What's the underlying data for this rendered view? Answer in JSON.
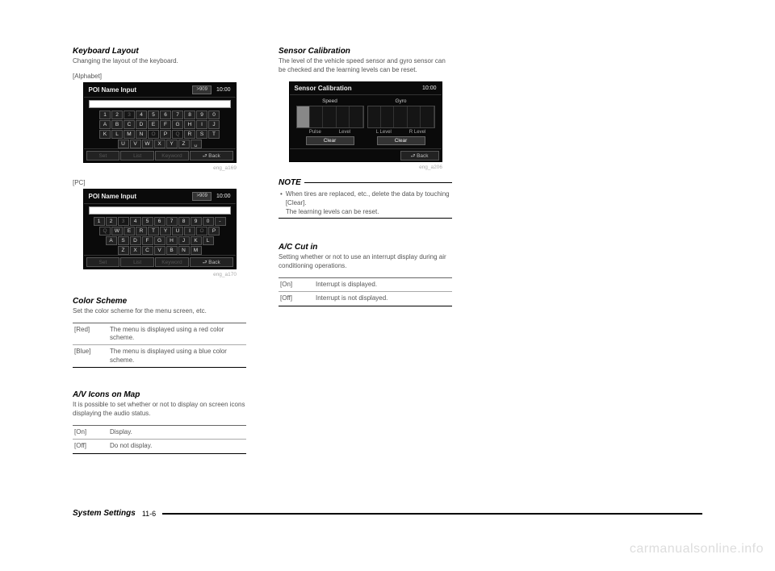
{
  "left": {
    "kb": {
      "title": "Keyboard Layout",
      "desc": "Changing the layout of the keyboard.",
      "alpha_label": "[Alphabet]",
      "pc_label": "[PC]"
    },
    "ss_common": {
      "title": "POI Name Input",
      "badge": ">909",
      "clock": "10:00",
      "f_set": "Set",
      "f_list": "List",
      "f_key": "Keyword",
      "f_back": "⮐ Back"
    },
    "alpha_rows": [
      [
        "1",
        "2",
        "3",
        "4",
        "5",
        "6",
        "7",
        "8",
        "9",
        "0"
      ],
      [
        "A",
        "B",
        "C",
        "D",
        "E",
        "F",
        "G",
        "H",
        "I",
        "J"
      ],
      [
        "K",
        "L",
        "M",
        "N",
        "O",
        "P",
        "Q",
        "R",
        "S",
        "T"
      ],
      [
        "U",
        "V",
        "W",
        "X",
        "Y",
        "Z",
        "␣",
        "",
        "",
        ""
      ]
    ],
    "pc_rows": [
      [
        "1",
        "2",
        "3",
        "4",
        "5",
        "6",
        "7",
        "8",
        "9",
        "0",
        "-"
      ],
      [
        "Q",
        "W",
        "E",
        "R",
        "T",
        "Y",
        "U",
        "I",
        "O",
        "P"
      ],
      [
        "A",
        "S",
        "D",
        "F",
        "G",
        "H",
        "J",
        "K",
        "L"
      ],
      [
        "Z",
        "X",
        "C",
        "V",
        "B",
        "N",
        "M"
      ]
    ],
    "cap_alpha": "eng_a169",
    "cap_pc": "eng_a170",
    "color": {
      "title": "Color Scheme",
      "desc": "Set the color scheme for the menu screen, etc.",
      "rows": [
        {
          "k": "[Red]",
          "v": "The menu is displayed using a red color scheme."
        },
        {
          "k": "[Blue]",
          "v": "The menu is displayed using a blue color scheme."
        }
      ]
    },
    "av": {
      "title": "A/V Icons on Map",
      "desc": "It is possible to set whether or not to display on screen icons displaying the audio status.",
      "rows": [
        {
          "k": "[On]",
          "v": "Display."
        },
        {
          "k": "[Off]",
          "v": "Do not display."
        }
      ]
    }
  },
  "right": {
    "sensor": {
      "title": "Sensor Calibration",
      "desc": "The level of the vehicle speed sensor and gyro sensor can be checked and the learning levels can be reset.",
      "ss_title": "Sensor Calibration",
      "clock": "10:00",
      "speed": "Speed",
      "gyro": "Gyro",
      "pulse": "Pulse",
      "level": "Level",
      "llevel": "L Level",
      "rlevel": "R Level",
      "clear": "Clear",
      "back": "⮐ Back",
      "cap": "eng_a206"
    },
    "note": {
      "head": "NOTE",
      "line1": "When tires are replaced, etc., delete the data by touching [Clear].",
      "line2": "The learning levels can be reset."
    },
    "ac": {
      "title": "A/C Cut in",
      "desc": "Setting whether or not to use an interrupt display during air conditioning operations.",
      "rows": [
        {
          "k": "[On]",
          "v": "Interrupt is displayed."
        },
        {
          "k": "[Off]",
          "v": "Interrupt is not displayed."
        }
      ]
    }
  },
  "footer": {
    "title": "System Settings",
    "page": "11-6"
  },
  "watermark": "carmanualsonline.info"
}
